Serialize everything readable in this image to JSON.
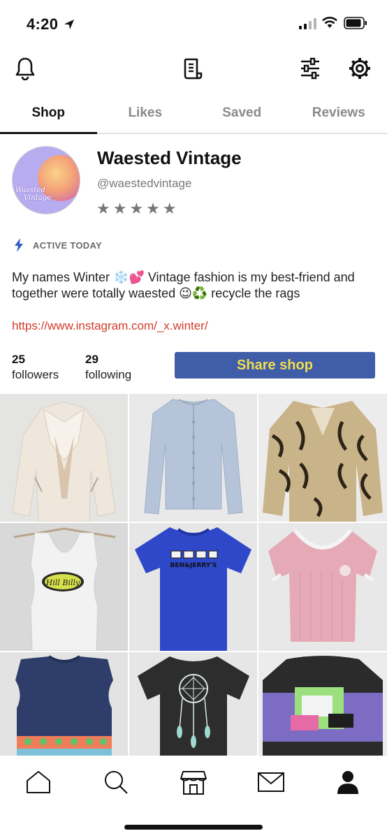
{
  "status_bar": {
    "time": "4:20"
  },
  "tabs": [
    {
      "label": "Shop",
      "active": true
    },
    {
      "label": "Likes",
      "active": false
    },
    {
      "label": "Saved",
      "active": false
    },
    {
      "label": "Reviews",
      "active": false
    }
  ],
  "profile": {
    "shop_name": "Waested Vintage",
    "handle": "@waestedvintage",
    "stars": "★★★★★",
    "avatar_text_line1": "Waested",
    "avatar_text_line2": "Vintage",
    "active_status": "ACTIVE TODAY",
    "bio": "My names Winter ❄️💕 Vintage fashion is my best-friend and together were totally waested 😉♻️ recycle the rags",
    "link": "https://www.instagram.com/_x.winter/"
  },
  "stats": {
    "followers_count": "25",
    "followers_label": "followers",
    "following_count": "29",
    "following_label": "following"
  },
  "share_button_label": "Share shop",
  "colors": {
    "accent_button": "#3f5da9",
    "button_text": "#f1dd4d",
    "link": "#d23b2a",
    "active_icon": "#2f5fc4"
  },
  "grid_items": [
    "cream-leather-jacket",
    "light-blue-cardigan",
    "tiger-print-jacket",
    "white-tank-top",
    "blue-ben-jerrys-tshirt",
    "pink-knit-top",
    "navy-knit-vest",
    "dreamcatcher-tshirt",
    "purple-graphic-sweater"
  ],
  "grid_texts": {
    "hillbilly_logo": "Hill Billy",
    "ben_jerrys": "BEN&JERRY'S"
  }
}
